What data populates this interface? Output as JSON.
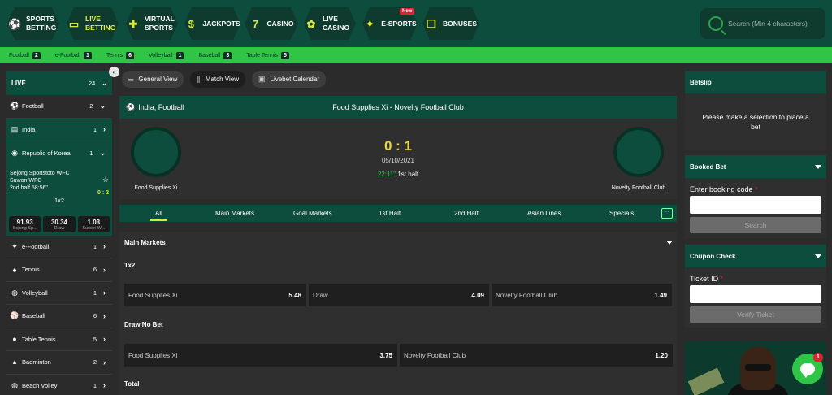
{
  "nav": {
    "items": [
      {
        "label": "Sports Betting",
        "icon": "soccer-ball-icon"
      },
      {
        "label": "Live Betting",
        "icon": "tv-icon"
      },
      {
        "label": "Virtual Sports",
        "icon": "gamepad-icon"
      },
      {
        "label": "Jackpots",
        "icon": "dollar-icon"
      },
      {
        "label": "Casino",
        "icon": "seven-icon"
      },
      {
        "label": "Live Casino",
        "icon": "chip-icon"
      },
      {
        "label": "E-Sports",
        "icon": "controller-icon"
      },
      {
        "label": "Bonuses",
        "icon": "gift-icon"
      }
    ],
    "new_badge": "New",
    "search_placeholder": "Search (Min 4 characters)"
  },
  "sportsbar": [
    {
      "name": "Football",
      "count": "2"
    },
    {
      "name": "e-Football",
      "count": "1"
    },
    {
      "name": "Tennis",
      "count": "6"
    },
    {
      "name": "Volleyball",
      "count": "1"
    },
    {
      "name": "Baseball",
      "count": "3"
    },
    {
      "name": "Table Tennis",
      "count": "5"
    }
  ],
  "left": {
    "live_label": "LIVE",
    "live_count": "24",
    "football": {
      "name": "Football",
      "count": "2"
    },
    "india": {
      "name": "India",
      "count": "1"
    },
    "korea": {
      "name": "Republic of Korea",
      "count": "1"
    },
    "match": {
      "home": "Sejong Sportstoto WFC",
      "away": "Suwon WFC",
      "time": "2nd half 58:56\"",
      "score": "0 : 2",
      "market": "1x2",
      "odds": [
        {
          "value": "91.93",
          "label": "Sejong Sp..."
        },
        {
          "value": "30.34",
          "label": "Draw"
        },
        {
          "value": "1.03",
          "label": "Suwon W..."
        }
      ]
    },
    "sports": [
      {
        "name": "e-Football",
        "count": "1",
        "icon": "controller-icon"
      },
      {
        "name": "Tennis",
        "count": "6",
        "icon": "tennis-racket-icon"
      },
      {
        "name": "Volleyball",
        "count": "1",
        "icon": "volleyball-icon"
      },
      {
        "name": "Baseball",
        "count": "6",
        "icon": "baseball-icon"
      },
      {
        "name": "Table Tennis",
        "count": "5",
        "icon": "table-tennis-icon"
      },
      {
        "name": "Badminton",
        "count": "2",
        "icon": "shuttlecock-icon"
      },
      {
        "name": "Beach Volley",
        "count": "1",
        "icon": "beach-volley-icon"
      }
    ]
  },
  "views": [
    "General View",
    "Match View",
    "Livebet Calendar"
  ],
  "match": {
    "league": "India, Football",
    "title": "Food Supplies Xi - Novelty Football Club",
    "home": "Food Supplies Xi",
    "away": "Novelty Football Club",
    "score": "0 : 1",
    "date": "05/10/2021",
    "minute": "22:11\"",
    "period": "1st half"
  },
  "tabs": [
    "All",
    "Main Markets",
    "Goal Markets",
    "1st Half",
    "2nd Half",
    "Asian Lines",
    "Specials"
  ],
  "markets": {
    "header": "Main Markets",
    "m1": {
      "title": "1x2",
      "odds": [
        {
          "label": "Food Supplies Xi",
          "value": "5.48"
        },
        {
          "label": "Draw",
          "value": "4.09"
        },
        {
          "label": "Novelty Football Club",
          "value": "1.49"
        }
      ]
    },
    "m2": {
      "title": "Draw No Bet",
      "odds": [
        {
          "label": "Food Supplies Xi",
          "value": "3.75"
        },
        {
          "label": "Novelty Football Club",
          "value": "1.20"
        }
      ]
    },
    "m3": {
      "title": "Total"
    }
  },
  "betslip": {
    "title": "Betslip",
    "message": "Please make a selection to place a bet"
  },
  "booked": {
    "title": "Booked Bet",
    "label": "Enter booking code",
    "required": "*",
    "button": "Search"
  },
  "coupon": {
    "title": "Coupon Check",
    "label": "Ticket ID",
    "required": "*",
    "button": "Verify Ticket"
  },
  "chat_badge": "1"
}
